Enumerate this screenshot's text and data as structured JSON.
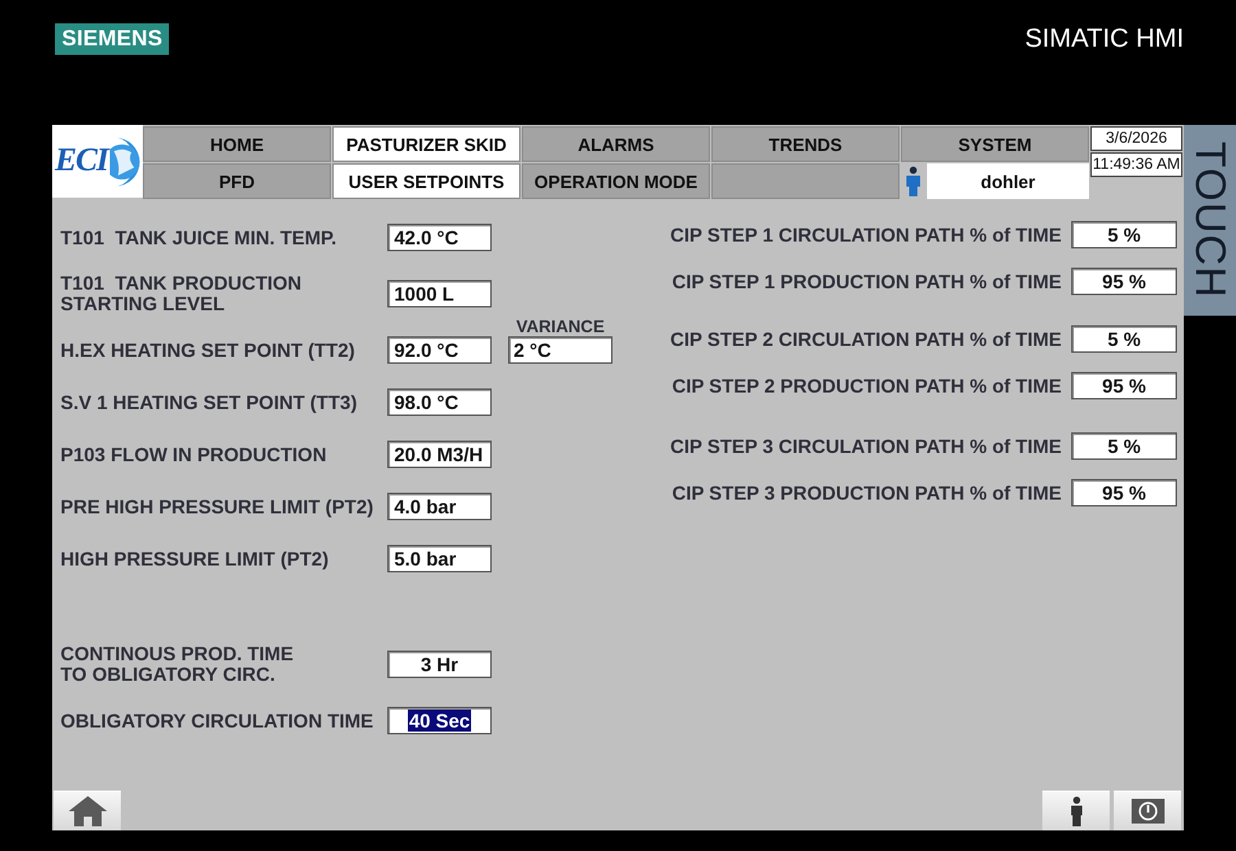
{
  "device": {
    "brand": "SIEMENS",
    "model": "SIMATIC HMI",
    "side_label": "TOUCH"
  },
  "header": {
    "logo_text": "ECI",
    "nav_rows": [
      {
        "buttons": [
          {
            "label": "HOME",
            "selected": false
          },
          {
            "label": "PASTURIZER SKID",
            "selected": true
          },
          {
            "label": "ALARMS",
            "selected": false
          },
          {
            "label": "TRENDS",
            "selected": false
          },
          {
            "label": "SYSTEM",
            "selected": false
          }
        ]
      },
      {
        "buttons": [
          {
            "label": "PFD",
            "selected": false
          },
          {
            "label": "USER SETPOINTS",
            "selected": true
          },
          {
            "label": "OPERATION MODE",
            "selected": false
          },
          {
            "selected": false
          }
        ]
      }
    ],
    "user": "dohler",
    "date": "3/6/2026",
    "time": "11:49:36 AM"
  },
  "setpoints": [
    {
      "label": "T101  TANK JUICE MIN. TEMP.",
      "value": "42.0 °C",
      "selected": false
    },
    {
      "label": "T101  TANK PRODUCTION\nSTARTING LEVEL",
      "value": "1000 L",
      "selected": false
    },
    {
      "label": "H.EX HEATING SET POINT (TT2)",
      "value": "92.0 °C",
      "selected": false,
      "variance": {
        "label": "VARIANCE",
        "value": "2 °C"
      }
    },
    {
      "label": "S.V 1 HEATING SET POINT (TT3)",
      "value": "98.0 °C",
      "selected": false
    },
    {
      "label": "P103 FLOW IN PRODUCTION",
      "value": "20.0 M3/H",
      "selected": false
    },
    {
      "label": "PRE HIGH PRESSURE LIMIT (PT2)",
      "value": "4.0 bar",
      "selected": false
    },
    {
      "label": "HIGH PRESSURE LIMIT (PT2)",
      "value": "5.0 bar",
      "selected": false
    }
  ],
  "circulation": [
    {
      "label": "CONTINOUS PROD. TIME\nTO OBLIGATORY CIRC.",
      "value": "3 Hr",
      "selected": false
    },
    {
      "label": "OBLIGATORY CIRCULATION TIME",
      "value": "40 Sec",
      "selected": true
    }
  ],
  "cip_steps": [
    {
      "rows": [
        {
          "label": "CIP STEP 1 CIRCULATION PATH % of TIME",
          "value": "5 %"
        },
        {
          "label": "CIP STEP 1 PRODUCTION PATH % of TIME",
          "value": "95 %"
        }
      ]
    },
    {
      "rows": [
        {
          "label": "CIP STEP 2 CIRCULATION PATH % of TIME",
          "value": "5 %"
        },
        {
          "label": "CIP STEP 2 PRODUCTION PATH % of TIME",
          "value": "95 %"
        }
      ]
    },
    {
      "rows": [
        {
          "label": "CIP STEP 3 CIRCULATION PATH % of TIME",
          "value": "5 %"
        },
        {
          "label": "CIP STEP 3 PRODUCTION PATH % of TIME",
          "value": "95 %"
        }
      ]
    }
  ]
}
